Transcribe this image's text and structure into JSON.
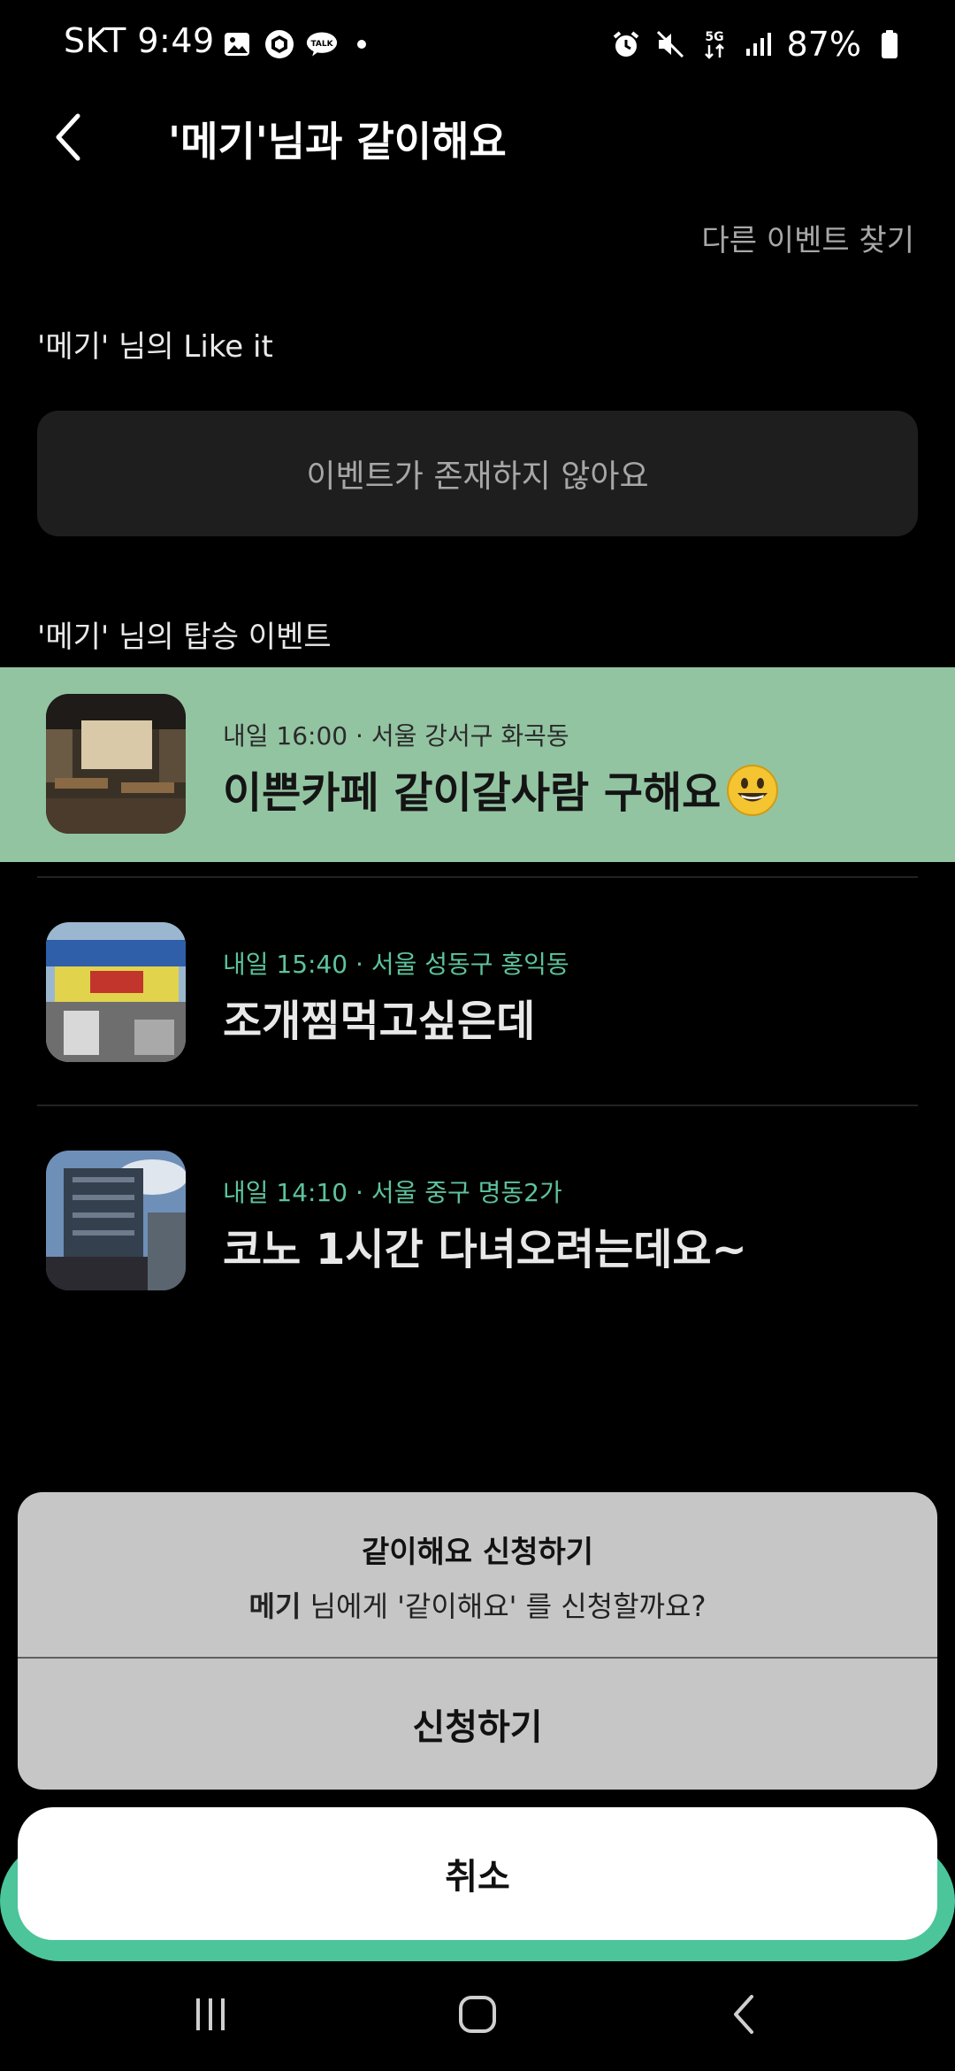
{
  "status_bar": {
    "carrier_time": "SKT 9:49",
    "network": "5G",
    "battery": "87%",
    "left_icons": [
      "gallery-icon",
      "box-icon",
      "talk-icon",
      "dot-icon"
    ],
    "right_icons": [
      "alarm-icon",
      "mute-icon",
      "5g-icon",
      "signal-icon",
      "battery-icon"
    ],
    "talk_label": "TALK"
  },
  "header": {
    "title": "'메기'님과 같이해요",
    "back_icon": "chevron-left-icon"
  },
  "find_other_events": "다른 이벤트 찾기",
  "like_section": {
    "title": "'메기' 님의 Like it",
    "empty_text": "이벤트가 존재하지 않아요"
  },
  "board_section": {
    "title": "'메기' 님의 탑승 이벤트",
    "events": [
      {
        "meta": "내일 16:00 · 서울 강서구 화곡동",
        "title": "이쁜카페 같이갈사람 구해요",
        "emoji": "grinning-face-icon",
        "selected": true
      },
      {
        "meta": "내일 15:40 · 서울 성동구 홍익동",
        "title": "조개찜먹고싶은데",
        "selected": false
      },
      {
        "meta": "내일 14:10 · 서울 중구 명동2가",
        "title": "코노 1시간 다녀오려는데요~",
        "selected": false
      }
    ]
  },
  "dialog": {
    "title": "같이해요 신청하기",
    "desc_name": "메기",
    "desc_rest": " 님에게 '같이해요' 를 신청할까요?",
    "confirm_label": "신청하기",
    "cancel_label": "취소"
  },
  "colors": {
    "highlight": "#93c4a2",
    "accent": "#4cc59a",
    "meta_green": "#5dc39c"
  },
  "nav_bar": [
    "recents-icon",
    "home-icon",
    "back-icon"
  ]
}
